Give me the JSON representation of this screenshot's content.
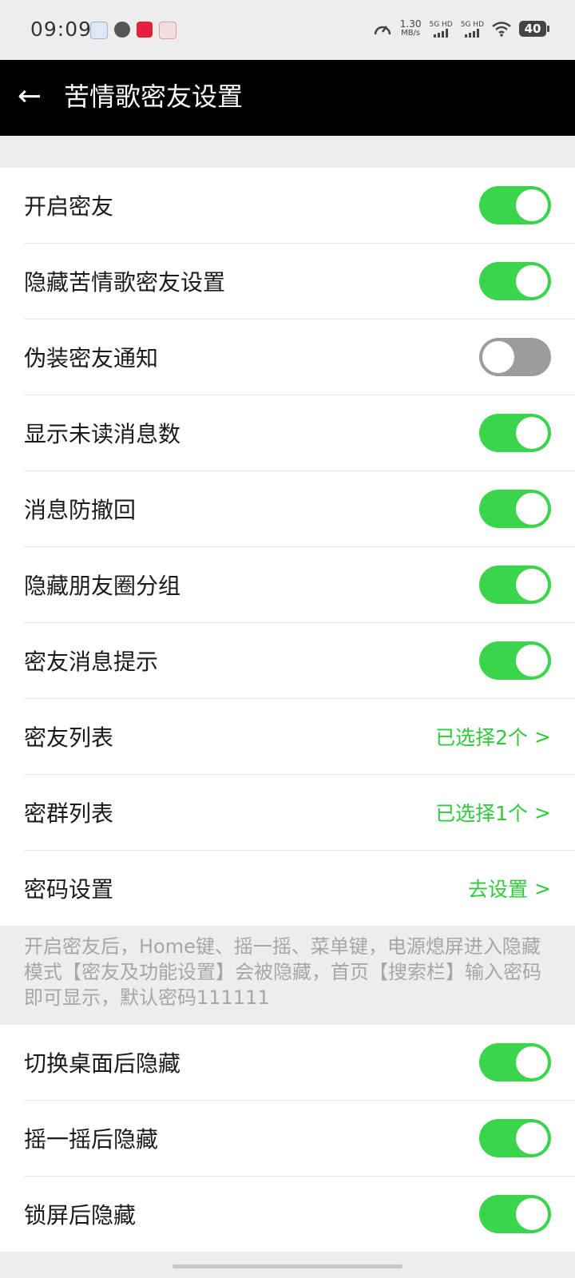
{
  "status_bar": {
    "time": "09:09",
    "speed_value": "1.30",
    "speed_unit": "MB/s",
    "sim1": "5G HD",
    "sim2": "5G HD",
    "battery": "40"
  },
  "header": {
    "title": "苦情歌密友设置"
  },
  "colors": {
    "toggle_on": "#3ad54a",
    "toggle_off": "#9c9c9c",
    "value_green": "#2fca3b"
  },
  "section1": {
    "items": [
      {
        "label": "开启密友",
        "on": true
      },
      {
        "label": "隐藏苦情歌密友设置",
        "on": true
      },
      {
        "label": "伪装密友通知",
        "on": false
      },
      {
        "label": "显示未读消息数",
        "on": true
      },
      {
        "label": "消息防撤回",
        "on": true
      },
      {
        "label": "隐藏朋友圈分组",
        "on": true
      },
      {
        "label": "密友消息提示",
        "on": true
      },
      {
        "label": "密友列表",
        "value": "已选择2个"
      },
      {
        "label": "密群列表",
        "value": "已选择1个"
      },
      {
        "label": "密码设置",
        "value": "去设置"
      }
    ]
  },
  "note": "开启密友后，Home键、摇一摇、菜单键，电源熄屏进入隐藏模式【密友及功能设置】会被隐藏，首页【搜索栏】输入密码即可显示，默认密码111111",
  "section2": {
    "items": [
      {
        "label": "切换桌面后隐藏",
        "on": true
      },
      {
        "label": "摇一摇后隐藏",
        "on": true
      },
      {
        "label": "锁屏后隐藏",
        "on": true
      }
    ]
  },
  "chevron": ">"
}
